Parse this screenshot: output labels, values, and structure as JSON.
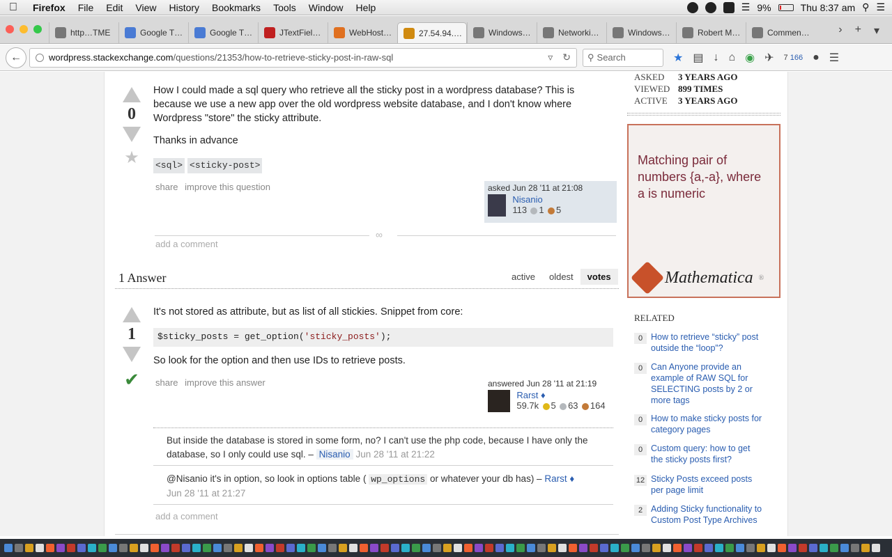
{
  "menubar": {
    "app": "Firefox",
    "items": [
      "File",
      "Edit",
      "View",
      "History",
      "Bookmarks",
      "Tools",
      "Window",
      "Help"
    ],
    "battery": "9%",
    "clock": "Thu 8:37 am"
  },
  "tabs": [
    {
      "label": "http…TME",
      "color": "#777"
    },
    {
      "label": "Google T…",
      "color": "#4a7bd4"
    },
    {
      "label": "Google T…",
      "color": "#4a7bd4"
    },
    {
      "label": "JTextFiel…",
      "color": "#c02020"
    },
    {
      "label": "WebHost…",
      "color": "#e07020"
    },
    {
      "label": "27.54.94.…",
      "color": "#d08a10",
      "active": true
    },
    {
      "label": "Windows…",
      "color": "#777"
    },
    {
      "label": "Networki…",
      "color": "#777"
    },
    {
      "label": "Windows…",
      "color": "#777"
    },
    {
      "label": "Robert M…",
      "color": "#777"
    },
    {
      "label": "Commen…",
      "color": "#777"
    }
  ],
  "nav": {
    "url_host": "wordpress.stackexchange.com",
    "url_path": "/questions/21353/how-to-retrieve-sticky-post-in-raw-sql",
    "search_placeholder": "Search",
    "notif_count_a": "7",
    "notif_count_b": "166"
  },
  "question": {
    "votes": "0",
    "body": "How I could made a sql query who retrieve all the sticky post in a wordpress database? This is because we use a new app over the old wordpress website database, and I don't know where Wordpress \"store\" the sticky attribute.",
    "thanks": "Thanks in advance",
    "tags": [
      "<sql>",
      "<sticky-post>"
    ],
    "menu": {
      "share": "share",
      "improve": "improve this question"
    },
    "asked": "asked Jun 28 '11 at 21:08",
    "user": "Nisanio",
    "rep": "113",
    "silver": "1",
    "bronze": "5",
    "add_comment": "add a comment"
  },
  "answers_header": "1 Answer",
  "sort_tabs": [
    "active",
    "oldest",
    "votes"
  ],
  "answer": {
    "votes": "1",
    "intro": "It's not stored as attribute, but as list of all stickies. Snippet from core:",
    "code_pre": "$sticky_posts = get_option(",
    "code_str": "'sticky_posts'",
    "code_post": ");",
    "outro": "So look for the option and then use IDs to retrieve posts.",
    "menu": {
      "share": "share",
      "improve": "improve this answer"
    },
    "answered": "answered Jun 28 '11 at 21:19",
    "user": "Rarst ♦",
    "rep": "59.7k",
    "gold": "5",
    "silver": "63",
    "bronze": "164",
    "add_comment": "add a comment"
  },
  "comments": [
    {
      "text": "But inside the database is stored in some form, no? I can't use the php code, because I have only the database, so I only could use sql. –",
      "user": "Nisanio",
      "date": "Jun 28 '11 at 21:22"
    },
    {
      "pre": "@Nisanio it's in option, so look in options table (",
      "code": "wp_options",
      "post": " or whatever your db has) –",
      "user": "Rarst ♦",
      "date": "Jun 28 '11 at 21:27"
    }
  ],
  "stats": [
    {
      "k": "ASKED",
      "v": "3 YEARS AGO"
    },
    {
      "k": "VIEWED",
      "v": "899 TIMES"
    },
    {
      "k": "ACTIVE",
      "v": "3 YEARS AGO"
    }
  ],
  "ad": {
    "text": "Matching pair of numbers {a,-a}, where a is numeric",
    "brand": "Mathematica",
    "reg": "®"
  },
  "related_header": "RELATED",
  "related": [
    {
      "n": "0",
      "t": "How to retrieve “sticky” post outside the “loop”?"
    },
    {
      "n": "0",
      "t": "Can Anyone provide an example of RAW SQL for SELECTING posts by 2 or more tags"
    },
    {
      "n": "0",
      "t": "How to make sticky posts for category pages"
    },
    {
      "n": "0",
      "t": "Custom query: how to get the sticky posts first?"
    },
    {
      "n": "12",
      "t": "Sticky Posts exceed posts per page limit"
    },
    {
      "n": "2",
      "t": "Adding Sticky functionality to Custom Post Type Archives"
    }
  ]
}
